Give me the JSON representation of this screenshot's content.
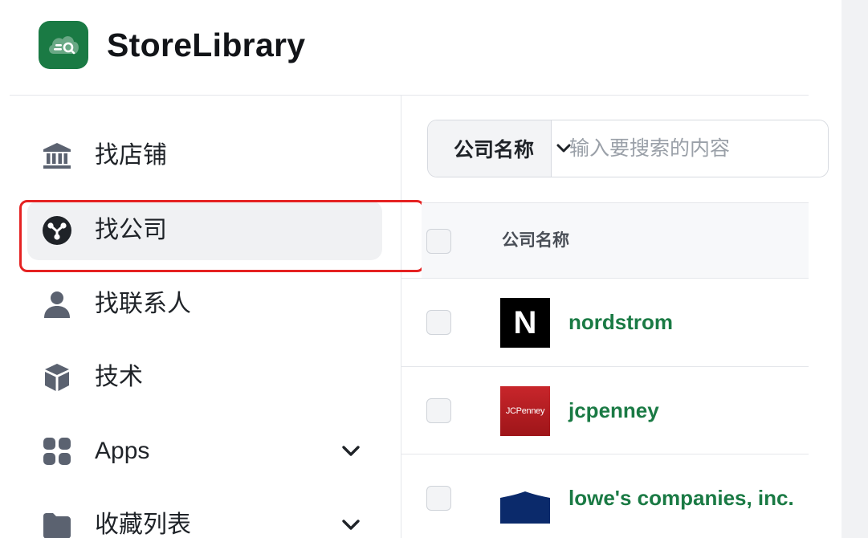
{
  "brand": {
    "name": "StoreLibrary",
    "logo_icon": "cloud-search-icon",
    "accent_color": "#1a7a44"
  },
  "sidebar": {
    "items": [
      {
        "label": "找店铺",
        "icon": "bank-icon",
        "active": false
      },
      {
        "label": "找公司",
        "icon": "network-icon",
        "active": true
      },
      {
        "label": "找联系人",
        "icon": "person-icon",
        "active": false
      },
      {
        "label": "技术",
        "icon": "cube-icon",
        "active": false
      },
      {
        "label": "Apps",
        "icon": "grid-icon",
        "active": false,
        "expandable": true
      },
      {
        "label": "收藏列表",
        "icon": "folder-icon",
        "active": false,
        "expandable": true
      }
    ]
  },
  "search": {
    "field_select": "公司名称",
    "placeholder": "输入要搜索的内容",
    "value": ""
  },
  "table": {
    "columns": [
      "公司名称"
    ],
    "rows": [
      {
        "name": "nordstrom",
        "logo_text": "N"
      },
      {
        "name": "jcpenney",
        "logo_text": "JCPenney"
      },
      {
        "name": "lowe's companies, inc.",
        "logo_text": ""
      }
    ]
  },
  "annotation": {
    "highlight_color": "#e52222"
  }
}
